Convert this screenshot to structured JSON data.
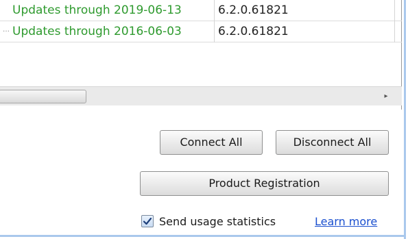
{
  "rows": [
    {
      "description": "Updates through 2019-06-13",
      "version": "6.2.0.61821"
    },
    {
      "description": "Updates through 2016-06-03",
      "version": "6.2.0.61821"
    }
  ],
  "buttons": {
    "connect_all": "Connect All",
    "disconnect_all": "Disconnect All",
    "product_registration": "Product Registration"
  },
  "usage": {
    "checkbox_checked": true,
    "label": "Send usage statistics",
    "link": "Learn more"
  },
  "icons": {
    "scroll_right": "chevron-right-icon",
    "checkmark": "checkmark-icon"
  },
  "colors": {
    "description_text": "#2e9a2e",
    "link": "#1a4fcf",
    "frame": "#a9c8ec"
  }
}
